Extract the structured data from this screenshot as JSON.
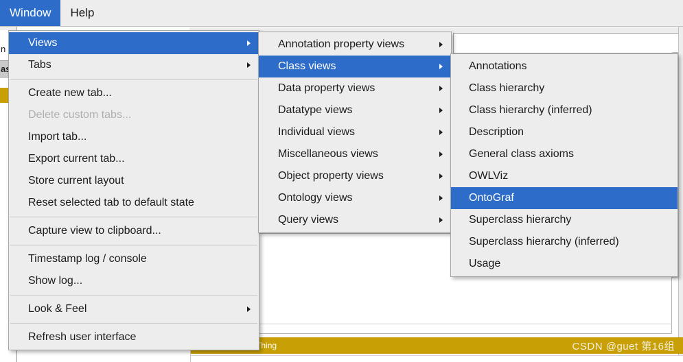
{
  "menubar": {
    "items": [
      {
        "label": "Window",
        "selected": true
      },
      {
        "label": "Help",
        "selected": false
      }
    ]
  },
  "window_menu": {
    "items": [
      {
        "label": "Views",
        "highlight": true,
        "submenu": true,
        "disabled": false
      },
      {
        "label": "Tabs",
        "highlight": false,
        "submenu": true,
        "disabled": false
      },
      {
        "separator": true
      },
      {
        "label": "Create new tab...",
        "highlight": false,
        "submenu": false,
        "disabled": false
      },
      {
        "label": "Delete custom tabs...",
        "highlight": false,
        "submenu": false,
        "disabled": true
      },
      {
        "label": "Import tab...",
        "highlight": false,
        "submenu": false,
        "disabled": false
      },
      {
        "label": "Export current tab...",
        "highlight": false,
        "submenu": false,
        "disabled": false
      },
      {
        "label": "Store current layout",
        "highlight": false,
        "submenu": false,
        "disabled": false
      },
      {
        "label": "Reset selected tab to default state",
        "highlight": false,
        "submenu": false,
        "disabled": false
      },
      {
        "separator": true
      },
      {
        "label": "Capture view to clipboard...",
        "highlight": false,
        "submenu": false,
        "disabled": false
      },
      {
        "separator": true
      },
      {
        "label": "Timestamp log / console",
        "highlight": false,
        "submenu": false,
        "disabled": false
      },
      {
        "label": "Show log...",
        "highlight": false,
        "submenu": false,
        "disabled": false
      },
      {
        "separator": true
      },
      {
        "label": "Look & Feel",
        "highlight": false,
        "submenu": true,
        "disabled": false
      },
      {
        "separator": true
      },
      {
        "label": "Refresh user interface",
        "highlight": false,
        "submenu": false,
        "disabled": false
      }
    ]
  },
  "views_submenu": {
    "items": [
      {
        "label": "Annotation property views",
        "highlight": false,
        "submenu": true
      },
      {
        "label": "Class views",
        "highlight": true,
        "submenu": true
      },
      {
        "label": "Data property views",
        "highlight": false,
        "submenu": true
      },
      {
        "label": "Datatype views",
        "highlight": false,
        "submenu": true
      },
      {
        "label": "Individual views",
        "highlight": false,
        "submenu": true
      },
      {
        "label": "Miscellaneous views",
        "highlight": false,
        "submenu": true
      },
      {
        "label": "Object property views",
        "highlight": false,
        "submenu": true
      },
      {
        "label": "Ontology views",
        "highlight": false,
        "submenu": true
      },
      {
        "label": "Query views",
        "highlight": false,
        "submenu": true
      }
    ]
  },
  "class_views_submenu": {
    "items": [
      {
        "label": "Annotations",
        "highlight": false
      },
      {
        "label": "Class hierarchy",
        "highlight": false
      },
      {
        "label": "Class hierarchy (inferred)",
        "highlight": false
      },
      {
        "label": "Description",
        "highlight": false
      },
      {
        "label": "General class axioms",
        "highlight": false
      },
      {
        "label": "OWLViz",
        "highlight": false
      },
      {
        "label": "OntoGraf",
        "highlight": true
      },
      {
        "label": "Superclass hierarchy",
        "highlight": false
      },
      {
        "label": "Superclass hierarchy (inferred)",
        "highlight": false
      },
      {
        "label": "Usage",
        "highlight": false
      }
    ]
  },
  "background": {
    "left_strip_fragment_1": "n",
    "left_strip_fragment_2": "as",
    "status_bar_label": "Description: owl:Thing",
    "watermark": "CSDN @guet  第16组"
  },
  "colors": {
    "accent_blue": "#2d6cc8",
    "menu_background": "#ededed",
    "gold_bar": "#c8a005",
    "disabled_text": "#b0b0b0"
  }
}
